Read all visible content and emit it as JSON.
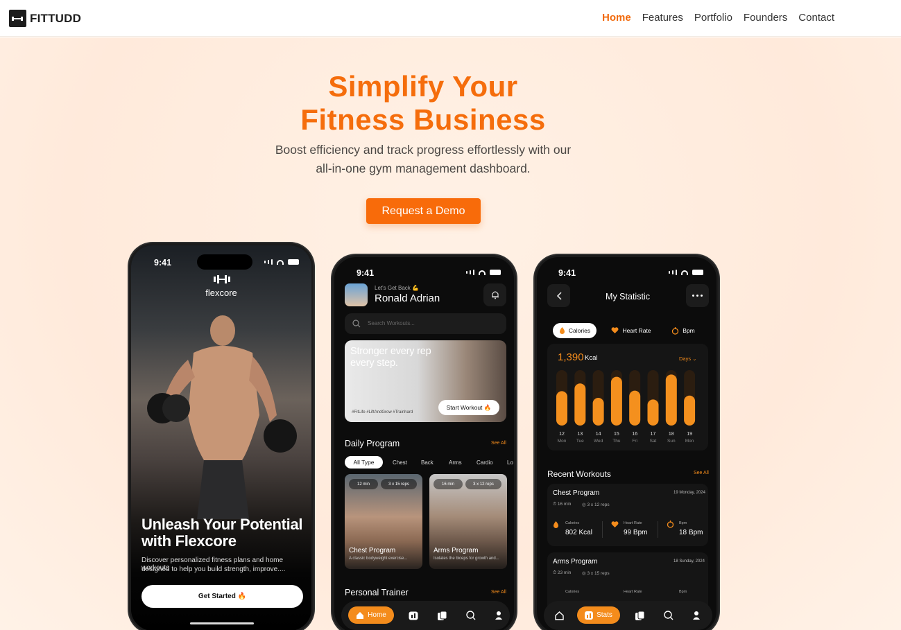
{
  "brand": {
    "name": "FITTUDD"
  },
  "nav": {
    "items": [
      "Home",
      "Features",
      "Portfolio",
      "Founders",
      "Contact"
    ]
  },
  "hero": {
    "title_line1": "Simplify Your",
    "title_line2": "Fitness Business",
    "subtitle_line1": "Boost efficiency and track progress effortlessly with our",
    "subtitle_line2": "all-in-one gym management dashboard.",
    "cta": "Request a Demo"
  },
  "phone1": {
    "time": "9:41",
    "app_name": "flexcore",
    "headline_line1": "Unleash Your Potential",
    "headline_line2": "with Flexcore",
    "desc_line1": "Discover personalized fitness plans and home workouts",
    "desc_line2": "designed to help you build strength, improve....",
    "button": "Get Started 🔥"
  },
  "phone2": {
    "time": "9:41",
    "greeting": "Let's Get Back 💪",
    "user": "Ronald Adrian",
    "search_placeholder": "Search Workouts...",
    "banner_line1": "Stronger every rep",
    "banner_line2": "every step.",
    "banner_tags": "#FitLife   #LiftAndGrow   #Trainhard",
    "banner_button": "Start Workout 🔥",
    "section_title": "Daily Program",
    "see_all": "See All",
    "filters": [
      "All Type",
      "Chest",
      "Back",
      "Arms",
      "Cardio",
      "Lo"
    ],
    "cards": [
      {
        "duration": "12 min",
        "reps": "3 x 15 reps",
        "title": "Chest Program",
        "desc": "A classic bodyweight exercise..."
      },
      {
        "duration": "16 min",
        "reps": "3 x 12 reps",
        "title": "Arms Program",
        "desc": "Isolates the biceps for growth and..."
      }
    ],
    "section2_title": "Personal Trainer",
    "see_all2": "See All",
    "tab_home": "Home"
  },
  "phone3": {
    "time": "9:41",
    "title": "My Statistic",
    "tabs": [
      "Calories",
      "Heart Rate",
      "Bpm"
    ],
    "kcal_value": "1,390",
    "kcal_unit": "Kcal",
    "range": "Days",
    "chart_data": {
      "type": "bar",
      "categories": [
        "12 Mon",
        "13 Tue",
        "14 Wed",
        "15 Thu",
        "16 Fri",
        "17 Sat",
        "18 Sun",
        "19 Mon"
      ],
      "days": [
        "12",
        "13",
        "14",
        "15",
        "16",
        "17",
        "18",
        "19"
      ],
      "weekdays": [
        "Mon",
        "Tue",
        "Wed",
        "Thu",
        "Fri",
        "Sat",
        "Sun",
        "Mon"
      ],
      "values": [
        62,
        76,
        50,
        88,
        63,
        47,
        92,
        54
      ],
      "ylim": [
        0,
        100
      ]
    },
    "recent_title": "Recent Workouts",
    "see_all": "See All",
    "workouts": [
      {
        "name": "Chest Program",
        "date": "19 Monday, 2024",
        "duration": "16 min",
        "reps": "3 x 12 reps",
        "cal_label": "Calories",
        "cal": "802 Kcal",
        "hr_label": "Heart Rate",
        "hr": "99 Bpm",
        "bpm_label": "Bpm",
        "bpm": "18 Bpm"
      },
      {
        "name": "Arms Program",
        "date": "18 Sunday, 2024",
        "duration": "23 min",
        "reps": "3 x 15 reps",
        "cal_label": "Calories",
        "hr_label": "Heart Rate",
        "bpm_label": "Bpm"
      }
    ],
    "tab_stats": "Stats"
  },
  "colors": {
    "accent": "#f56d0c",
    "chart_bar": "#f4901e",
    "dark": "#0c0c0c"
  }
}
